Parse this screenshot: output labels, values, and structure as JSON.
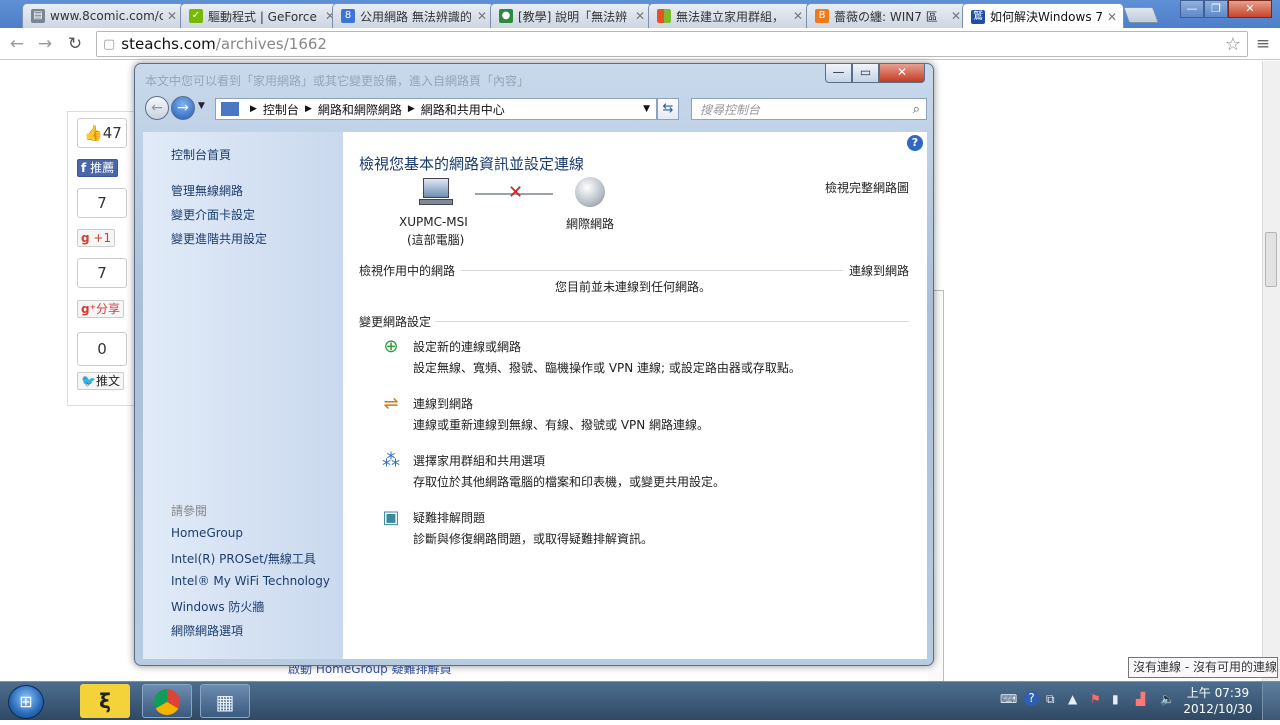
{
  "browser": {
    "tabs": [
      {
        "label": "www.8comic.com/c",
        "icon": "page-icon",
        "color": "#7a8594",
        "active": false
      },
      {
        "label": "驅動程式 | GeForce",
        "icon": "nvidia-icon",
        "color": "#76b900",
        "active": false
      },
      {
        "label": "公用網路 無法辨識的",
        "icon": "google-g-icon",
        "color": "#3b74d6",
        "active": false
      },
      {
        "label": "[教學] 說明「無法辨",
        "icon": "site-icon",
        "color": "#2b8a3e",
        "active": false
      },
      {
        "label": "無法建立家用群組，",
        "icon": "windows-icon",
        "color": "#e5522a",
        "active": false
      },
      {
        "label": "薔薇の纏: WIN7 區",
        "icon": "blogger-icon",
        "color": "#f07a1a",
        "active": false
      },
      {
        "label": "如何解決Windows 7",
        "icon": "site-icon-blue",
        "color": "#1f4fa0",
        "active": true
      }
    ],
    "url_domain": "steachs.com",
    "url_path": "/archives/1662"
  },
  "social": {
    "likes": "47",
    "fb_share": "推薦",
    "count_a": "7",
    "gplus_label": "+1",
    "count_b": "7",
    "gshare_label": "分享",
    "count_c": "0",
    "tweet_label": "推文"
  },
  "background_link": "啟動 HomeGroup 疑難排解員",
  "control_panel": {
    "title_faded": "本文中您可以看到「家用網路」或其它變更設備，進入自網路頁「內容」",
    "breadcrumb": [
      "控制台",
      "網路和網際網路",
      "網路和共用中心"
    ],
    "search_placeholder": "搜尋控制台",
    "sidebar": {
      "home": "控制台首頁",
      "links": [
        "管理無線網路",
        "變更介面卡設定",
        "變更進階共用設定"
      ],
      "see_also_title": "請參閱",
      "see_also": [
        "HomeGroup",
        "Intel(R) PROSet/無線工具",
        "Intel® My WiFi Technology",
        "Windows 防火牆",
        "網際網路選項"
      ]
    },
    "main": {
      "heading": "檢視您基本的網路資訊並設定連線",
      "view_full_map": "檢視完整網路圖",
      "computer_name": "XUPMC-MSI",
      "computer_sub": "(這部電腦)",
      "internet_label": "網際網路",
      "active_networks_title": "檢視作用中的網路",
      "connect_link": "連線到網路",
      "no_connection": "您目前並未連線到任何網路。",
      "change_settings_title": "變更網路設定",
      "tasks": [
        {
          "title": "設定新的連線或網路",
          "desc": "設定無線、寬頻、撥號、臨機操作或 VPN 連線; 或設定路由器或存取點。",
          "icon": "new-connection-icon"
        },
        {
          "title": "連線到網路",
          "desc": "連線或重新連線到無線、有線、撥號或 VPN 網路連線。",
          "icon": "connect-network-icon"
        },
        {
          "title": "選擇家用群組和共用選項",
          "desc": "存取位於其他網路電腦的檔案和印表機，或變更共用設定。",
          "icon": "homegroup-icon"
        },
        {
          "title": "疑難排解問題",
          "desc": "診斷與修復網路問題，或取得疑難排解資訊。",
          "icon": "troubleshoot-icon"
        }
      ]
    }
  },
  "taskbar": {
    "tooltip": "沒有連線 - 沒有可用的連線",
    "time": "上午 07:39",
    "date": "2012/10/30"
  }
}
